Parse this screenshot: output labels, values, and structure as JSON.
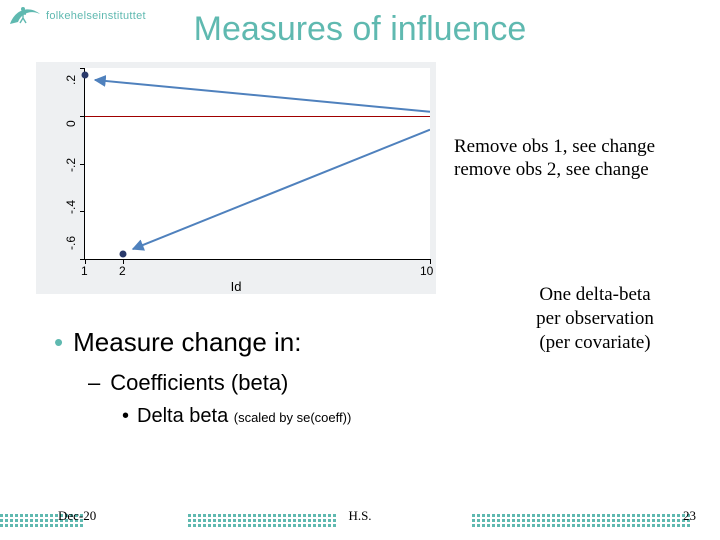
{
  "brand": {
    "name": "folkehelseinstituttet"
  },
  "title": "Measures of influence",
  "chart_data": {
    "type": "scatter",
    "xlabel": "Id",
    "ylabel": "",
    "x_ticks": [
      1,
      2,
      10
    ],
    "y_ticks": [
      -0.6,
      -0.4,
      -0.2,
      0,
      0.2
    ],
    "y_tick_labels": [
      "-.6",
      "-.4",
      "-.2",
      "0",
      ".2"
    ],
    "xlim": [
      1,
      10
    ],
    "ylim": [
      -0.6,
      0.2
    ],
    "ref_line_y": 0,
    "series": [
      {
        "name": "delta-beta",
        "points": [
          {
            "x": 1,
            "y": 0.17,
            "label": "obs 1"
          },
          {
            "x": 2,
            "y": -0.58,
            "label": "obs 2"
          }
        ]
      }
    ]
  },
  "right_text": {
    "line1": "Remove obs 1, see change",
    "line2": "remove  obs 2, see change"
  },
  "right_caption": {
    "line1": "One delta-beta",
    "line2": "per observation",
    "line3": "(per covariate)"
  },
  "bullets": {
    "l0": "Measure change in:",
    "l1": "Coefficients (beta)",
    "l2": "Delta beta",
    "l2_small": "(scaled by se(coeff))"
  },
  "footer": {
    "date": "Dec-20",
    "center": "H.S.",
    "page": "23"
  }
}
